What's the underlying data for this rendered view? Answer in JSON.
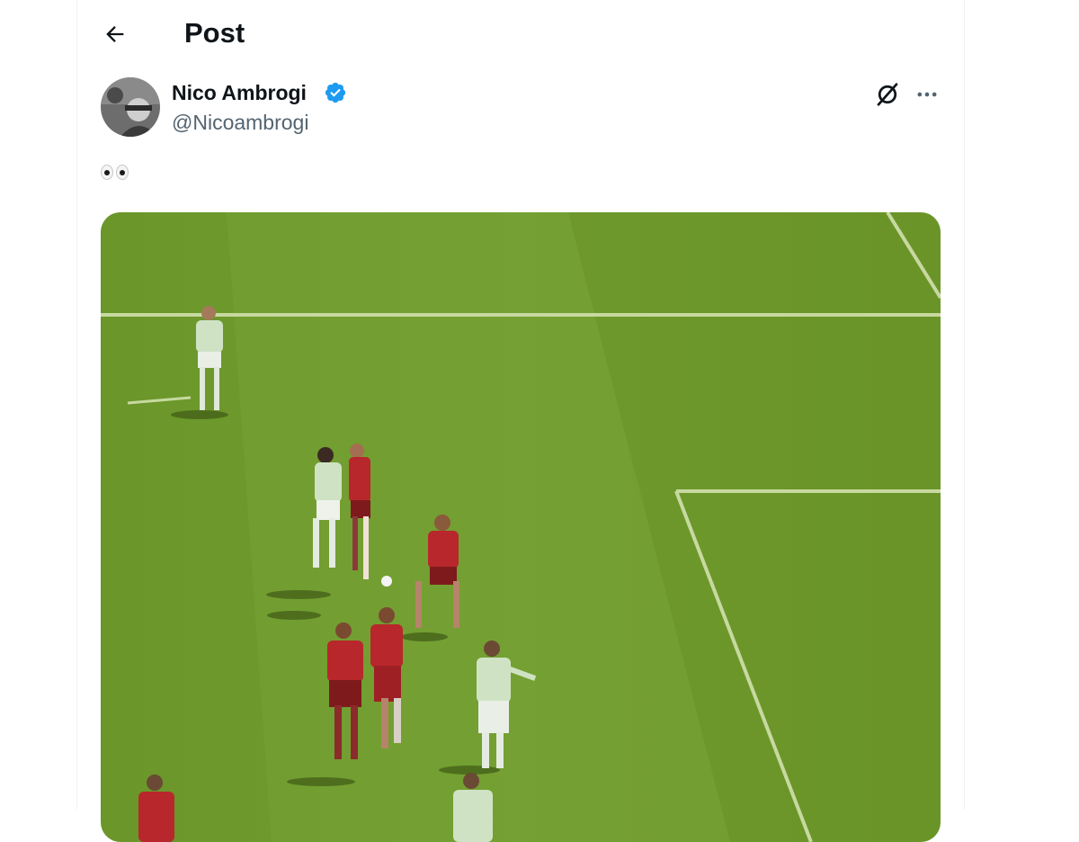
{
  "header": {
    "title": "Post",
    "back_icon": "arrow-left-icon"
  },
  "post": {
    "author": {
      "name": "Nico Ambrogi",
      "handle": "@Nicoambrogi",
      "verified": true,
      "verified_color": "#1d9bf0"
    },
    "text_emoji": "eyes-emoji",
    "media": {
      "type": "video-frame",
      "subject": "football pitch with players",
      "field_color": "#6e9a2a",
      "home_kit_color": "#b8272b",
      "away_kit_color": "#cfe3c4"
    }
  },
  "actions": {
    "grok_icon": "grok-icon",
    "more_icon": "more-horizontal-icon"
  }
}
